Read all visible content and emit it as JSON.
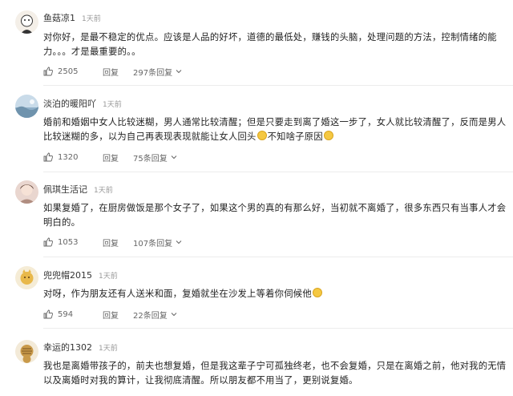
{
  "comments": [
    {
      "username": "鱼菇凉1",
      "time": "1天前",
      "text_html": "对你好，是最不稳定的优点。应该是人品的好坏，道德的最低处，赚钱的头脑，处理问题的方法，控制情绪的能力。。。才是最重要的。。",
      "likes": "2505",
      "reply_label": "回复",
      "reply_count": "297条回复",
      "avatar_icon": "avatar-cartoon-icon"
    },
    {
      "username": "淡泊的暖阳吖",
      "time": "1天前",
      "text_html": "婚前和婚姻中女人比较迷糊，男人通常比较清醒；但是只要走到离了婚这一步了，女人就比较清醒了，反而是男人比较迷糊的多，以为自己再表现表现就能让女人回头<span class=\"emoji\" data-name=\"laugh-emoji-icon\" data-interactable=\"false\"></span>不知啥子原因<span class=\"emoji\" data-name=\"smile-emoji-icon\" data-interactable=\"false\"></span>",
      "likes": "1320",
      "reply_label": "回复",
      "reply_count": "75条回复",
      "avatar_icon": "avatar-landscape-icon"
    },
    {
      "username": "佩琪生活记",
      "time": "1天前",
      "text_html": "如果复婚了，在厨房做饭是那个女子了，如果这个男的真的有那么好，当初就不离婚了，很多东西只有当事人才会明白的。",
      "likes": "1053",
      "reply_label": "回复",
      "reply_count": "107条回复",
      "avatar_icon": "avatar-photo-icon"
    },
    {
      "username": "兜兜帽2015",
      "time": "1天前",
      "text_html": "对呀，作为朋友还有人送米和面，复婚就坐在沙发上等着你伺候他<span class=\"emoji\" data-name=\"smile-emoji-icon\" data-interactable=\"false\"></span>",
      "likes": "594",
      "reply_label": "回复",
      "reply_count": "22条回复",
      "avatar_icon": "avatar-cartoon-icon"
    },
    {
      "username": "幸运的1302",
      "time": "1天前",
      "text_html": "我也是离婚带孩子的，前夫也想复婚，但是我这辈子宁可孤独终老，也不会复婚，只是在离婚之前，他对我的无情以及离婚时对我的算计，让我彻底清醒。所以朋友都不用当了，更别说复婚。",
      "likes": "",
      "reply_label": "",
      "reply_count": "",
      "avatar_icon": "avatar-cartoon-icon"
    }
  ],
  "colors": {
    "username": "#333333",
    "meta": "#999999",
    "text": "#222222",
    "action": "#666666",
    "divider": "#ececec"
  }
}
